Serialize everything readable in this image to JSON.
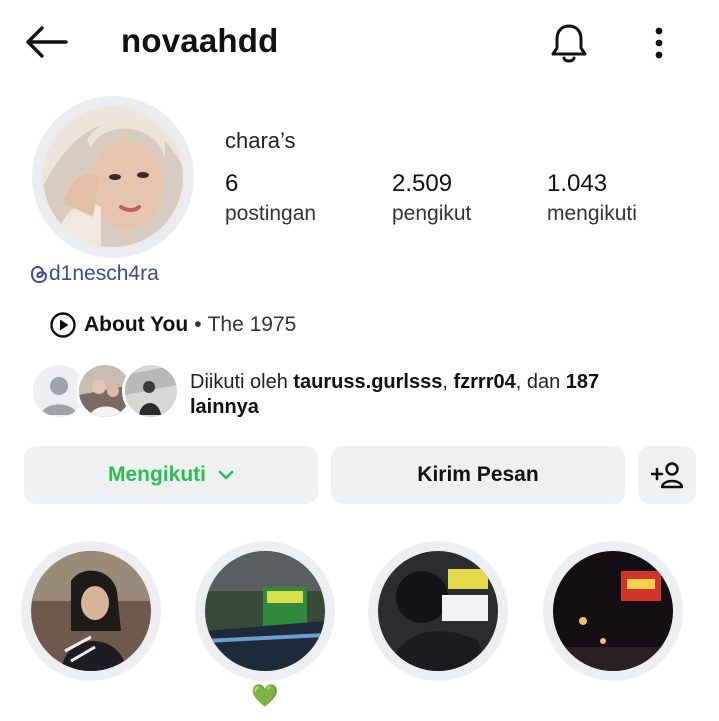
{
  "header": {
    "username": "novaahdd"
  },
  "profile": {
    "display_name": "chara’s",
    "stats": [
      {
        "value": "6",
        "label": "postingan"
      },
      {
        "value": "2.509",
        "label": "pengikut"
      },
      {
        "value": "1.043",
        "label": "mengikuti"
      }
    ],
    "threads_handle": "d1nesch4ra",
    "music": {
      "song": "About You",
      "separator": "•",
      "artist": "The 1975"
    },
    "followed_by": {
      "prefix": "Diikuti oleh ",
      "user1": "tauruss.gurlsss",
      "sep": ", ",
      "user2": "fzrrr04",
      "mid": ", dan ",
      "count": "187",
      "suffix": "lainnya"
    }
  },
  "actions": {
    "following_label": "Mengikuti",
    "message_label": "Kirim Pesan"
  },
  "highlights": [
    {
      "label": ""
    },
    {
      "label": "💚"
    },
    {
      "label": ""
    },
    {
      "label": ""
    }
  ],
  "colors": {
    "accent_green": "#2bbf4e",
    "button_bg": "#eff0f2",
    "threads_blue": "#3d4a9a"
  }
}
